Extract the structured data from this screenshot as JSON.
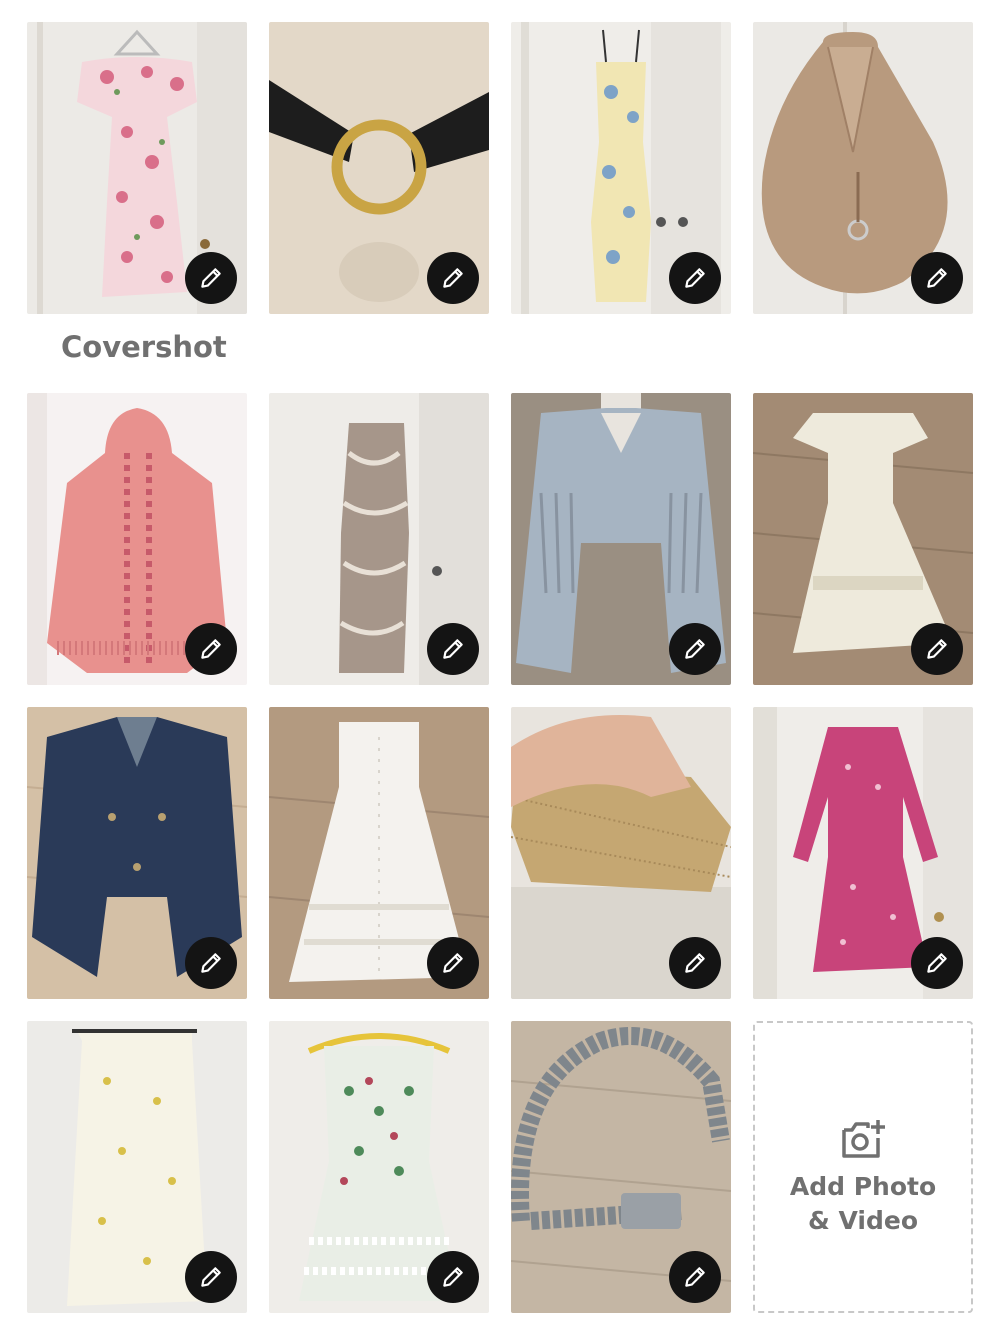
{
  "cover_label": "Covershot",
  "add_tile": {
    "line1": "Add Photo",
    "line2": "& Video"
  },
  "tiles": [
    {
      "item": "floral off-shoulder ruffle dress"
    },
    {
      "item": "black belt with gold ring"
    },
    {
      "item": "yellow floral slip dress"
    },
    {
      "item": "tan leather hobo bag"
    },
    {
      "item": "pink knit hooded poncho"
    },
    {
      "item": "zebra print slip dress"
    },
    {
      "item": "fringe denim jacket"
    },
    {
      "item": "white tiered maxi dress"
    },
    {
      "item": "dark denim jacket"
    },
    {
      "item": "white button front dress"
    },
    {
      "item": "gold mesh clutch"
    },
    {
      "item": "pink printed long sleeve dress"
    },
    {
      "item": "yellow floral midi skirt"
    },
    {
      "item": "green floral lace dress"
    },
    {
      "item": "silver metal chain belt"
    }
  ]
}
